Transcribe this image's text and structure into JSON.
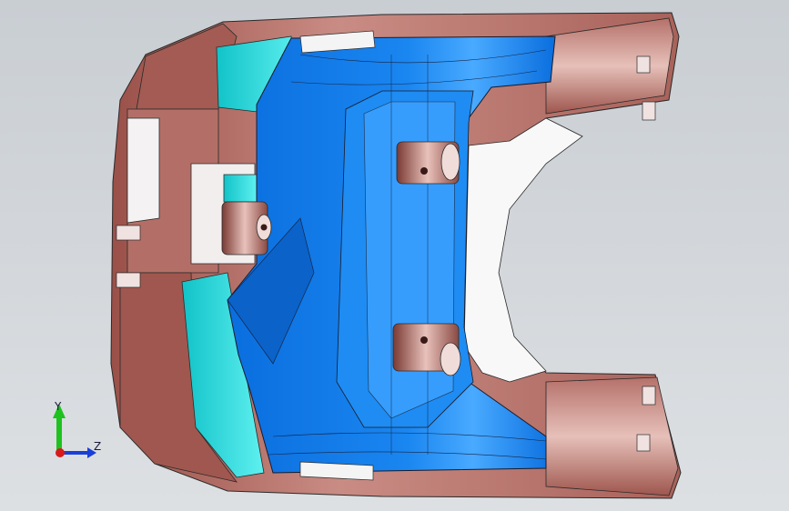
{
  "viewport": {
    "background_top": "#c9ced3",
    "background_bottom": "#dde0e3"
  },
  "model": {
    "shell_color": "#a8625a",
    "shell_highlight": "#e2b6ae",
    "liner_color": "#0a78e6",
    "liner_highlight": "#5fb8ff",
    "edge_color": "#2a2a2a",
    "teal_color": "#19d3d8"
  },
  "triad": {
    "y_label": "Y",
    "z_label": "Z",
    "y_axis_color": "#1ec21e",
    "z_axis_color": "#1a3fd8",
    "origin_color": "#d81a1a"
  }
}
